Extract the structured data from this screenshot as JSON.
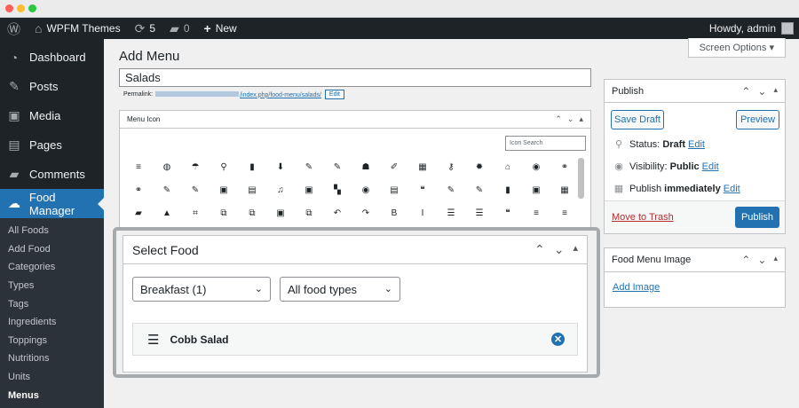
{
  "window": {
    "dot_colors": [
      "#ff5f57",
      "#febc2e",
      "#28c840"
    ]
  },
  "admin_bar": {
    "site_name": "WPFM Themes",
    "updates_count": "5",
    "comments_count": "0",
    "new_label": "New",
    "howdy": "Howdy, admin"
  },
  "sidebar": {
    "items": [
      {
        "label": "Dashboard",
        "icon": "dashboard-icon",
        "glyph": "◔"
      },
      {
        "label": "Posts",
        "icon": "pin-icon",
        "glyph": "✎"
      },
      {
        "label": "Media",
        "icon": "media-icon",
        "glyph": "▣"
      },
      {
        "label": "Pages",
        "icon": "pages-icon",
        "glyph": "▤"
      },
      {
        "label": "Comments",
        "icon": "comments-icon",
        "glyph": "▰"
      }
    ],
    "current": {
      "label": "Food Manager",
      "icon": "food-manager-icon",
      "glyph": "☁"
    },
    "submenu": [
      "All Foods",
      "Add Food",
      "Categories",
      "Types",
      "Tags",
      "Ingredients",
      "Toppings",
      "Nutritions",
      "Units",
      "Menus"
    ],
    "submenu_current_index": 9
  },
  "screen_options": "Screen Options ▾",
  "page_title": "Add Menu",
  "title_value": "Salads",
  "permalink": {
    "label": "Permalink:",
    "slug": "/index.php/food-menu/salads/",
    "edit": "Edit"
  },
  "menu_icon_box": {
    "title": "Menu Icon",
    "search_placeholder": "Icon Search",
    "icons": [
      "≡",
      "◍",
      "☂",
      "⚲",
      "▮",
      "⬇",
      "✎",
      "✎",
      "☗",
      "✐",
      "▦",
      "⚷",
      "✹",
      "⌂",
      "◉",
      "⚭",
      "⚭",
      "✎",
      "✎",
      "▣",
      "▤",
      "♫",
      "▣",
      "▚",
      "◉",
      "▤",
      "❝",
      "✎",
      "✎",
      "▮",
      "▣",
      "▦",
      "▰",
      "▲",
      "⌗",
      "⧉",
      "⧉",
      "▣",
      "⧉",
      "↶",
      "↷",
      "B",
      "I",
      "☰",
      "☰",
      "❝",
      "≡",
      "≡"
    ]
  },
  "select_food_box": {
    "title": "Select Food",
    "category_select": "Breakfast (1)",
    "type_select": "All food types",
    "items": [
      {
        "name": "Cobb Salad"
      }
    ]
  },
  "publish_box": {
    "title": "Publish",
    "save_draft": "Save Draft",
    "preview": "Preview",
    "status_label": "Status:",
    "status_value": "Draft",
    "visibility_label": "Visibility:",
    "visibility_value": "Public",
    "schedule_label": "Publish",
    "schedule_value": "immediately",
    "edit": "Edit",
    "move_to_trash": "Move to Trash",
    "publish_button": "Publish"
  },
  "food_menu_image_box": {
    "title": "Food Menu Image",
    "add_image": "Add Image"
  },
  "box_controls": {
    "up": "⌃",
    "down": "⌄",
    "toggle": "▴"
  }
}
